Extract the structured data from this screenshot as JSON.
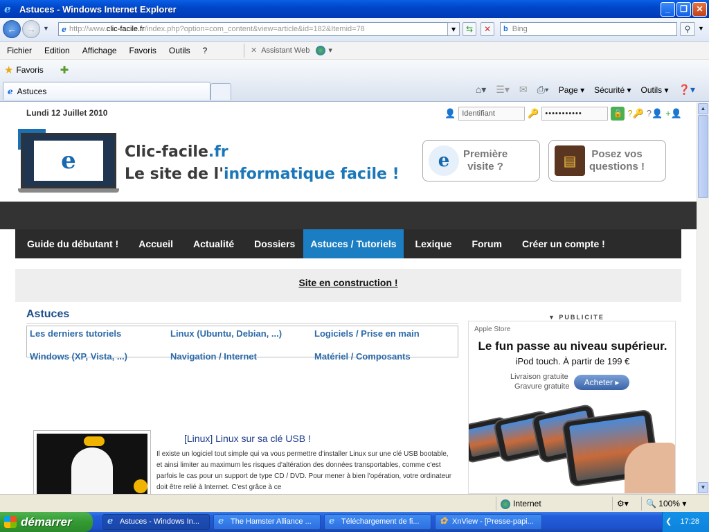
{
  "window": {
    "title": "Astuces - Windows Internet Explorer"
  },
  "address": {
    "url_prefix": "http://www.",
    "url_domain": "clic-facile.fr",
    "url_rest": "/index.php?option=com_content&view=article&id=182&Itemid=78",
    "search_placeholder": "Bing"
  },
  "menu": {
    "items": [
      "Fichier",
      "Edition",
      "Affichage",
      "Favoris",
      "Outils",
      "?"
    ],
    "assistant": "Assistant Web"
  },
  "favbar": {
    "favoris": "Favoris"
  },
  "tab": {
    "label": "Astuces"
  },
  "commandbar": {
    "page": "Page",
    "securite": "Sécurité",
    "outils": "Outils"
  },
  "site": {
    "date": "Lundi 12 Juillet 2010",
    "login_placeholder": "Identifiant",
    "password_mask": "•••••••••••",
    "name_line1_a": "Clic-facile",
    "name_line1_b": ".fr",
    "name_line2_a": "Le site de l'",
    "name_line2_b": "informatique facile !",
    "btn_first_visit": [
      "Première",
      "visite ?"
    ],
    "btn_questions": [
      "Posez vos",
      "questions !"
    ],
    "nav": [
      "Guide du débutant !",
      "Accueil",
      "Actualité",
      "Dossiers",
      "Astuces / Tutoriels",
      "Lexique",
      "Forum",
      "Créer un compte !"
    ],
    "construction": "Site en construction !",
    "section_title": "Astuces",
    "categories": [
      "Les derniers tutoriels",
      "Linux (Ubuntu, Debian, ...)",
      "Logiciels / Prise en main",
      "Windows (XP, Vista, ...)",
      "Navigation / Internet",
      "Matériel / Composants"
    ],
    "article_title": "[Linux] Linux sur sa clé USB !",
    "article_text": "Il existe un logiciel tout simple qui va vous permettre d'installer Linux sur une clé USB bootable, et ainsi limiter au maximum les risques d'altération des données transportables, comme c'est parfois le cas pour un support de type CD / DVD. Pour mener à bien l'opération, votre ordinateur doit être relié à Internet. C'est grâce à ce"
  },
  "ad": {
    "label": "PUBLICITE",
    "store": "Apple Store",
    "headline": "Le fun passe au niveau supérieur.",
    "sub": "iPod touch. À partir de 199 €",
    "line1": "Livraison gratuite",
    "line2": "Gravure gratuite",
    "buy": "Acheter"
  },
  "status": {
    "zone": "Internet",
    "zoom": "100%"
  },
  "taskbar": {
    "start": "démarrer",
    "items": [
      "Astuces - Windows In...",
      "The Hamster Alliance ...",
      "Téléchargement de fi...",
      "XnView - [Presse-papi..."
    ],
    "clock": "17:28"
  }
}
